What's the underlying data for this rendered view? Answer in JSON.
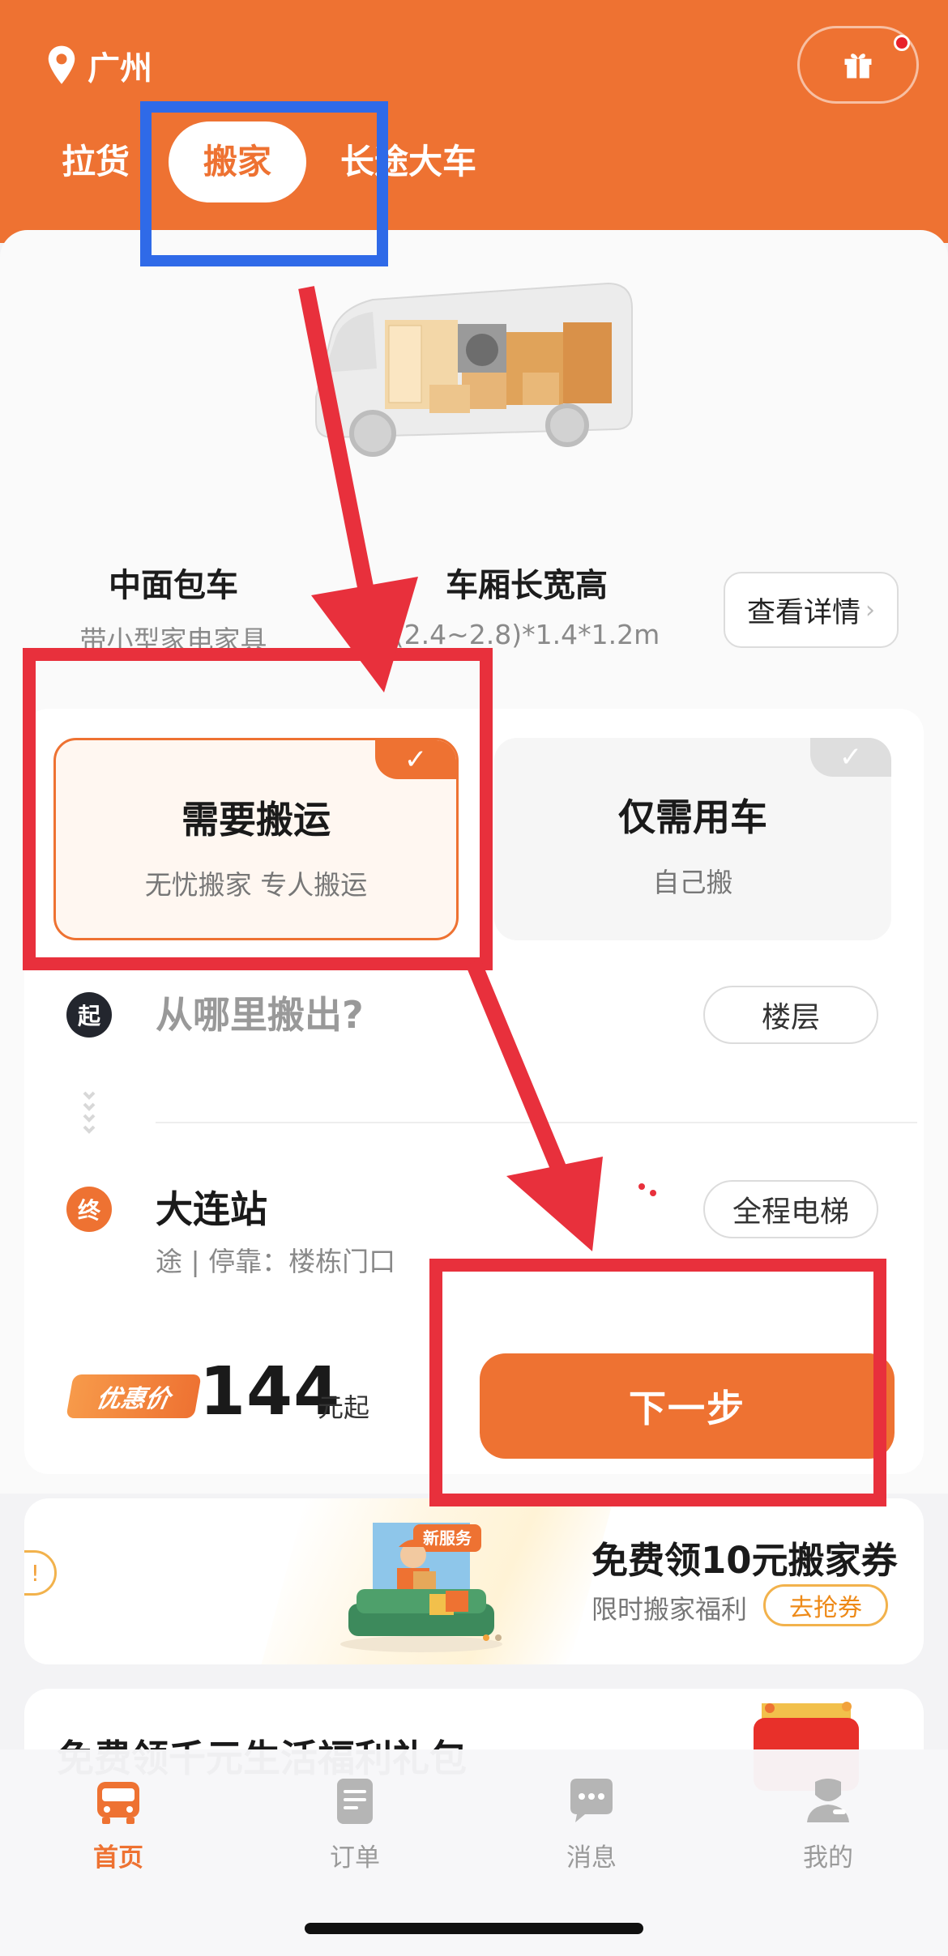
{
  "header": {
    "city": "广州",
    "icons": {
      "location": "location-pin-icon",
      "gift": "gift-icon"
    },
    "tabs": [
      {
        "label": "拉货",
        "active": false
      },
      {
        "label": "搬家",
        "active": true
      },
      {
        "label": "长途大车",
        "active": false
      }
    ]
  },
  "vehicle": {
    "name": "中面包车",
    "desc": "带小型家电家具",
    "dim_title": "车厢长宽高",
    "dims": "(2.4~2.8)*1.4*1.2m",
    "detail_button": "查看详情"
  },
  "service_options": [
    {
      "title": "需要搬运",
      "subtitle": "无忧搬家 专人搬运",
      "selected": true
    },
    {
      "title": "仅需用车",
      "subtitle": "自己搬",
      "selected": false
    }
  ],
  "route": {
    "start": {
      "marker": "起",
      "placeholder": "从哪里搬出?",
      "button": "楼层"
    },
    "end": {
      "marker": "终",
      "address": "大连站",
      "detail": "途 | 停靠：楼栋门口",
      "button": "全程电梯"
    }
  },
  "price": {
    "tag": "优惠价",
    "amount": "144",
    "unit": "元起",
    "next_button": "下一步"
  },
  "coupon_banner": {
    "left_partial": "!",
    "badge": "新服务",
    "title": "免费领10元搬家券",
    "subtitle": "限时搬家福利",
    "button": "去抢券"
  },
  "gift_banner": {
    "title": "免费领千元生活福利礼包"
  },
  "bottom_nav": [
    {
      "label": "首页",
      "icon": "truck-icon",
      "active": true
    },
    {
      "label": "订单",
      "icon": "order-document-icon",
      "active": false
    },
    {
      "label": "消息",
      "icon": "message-bubble-icon",
      "active": false
    },
    {
      "label": "我的",
      "icon": "profile-icon",
      "active": false
    }
  ],
  "colors": {
    "brand": "#ee7232",
    "annotation_blue": "#2f6ae8",
    "annotation_red": "#e8303c"
  }
}
